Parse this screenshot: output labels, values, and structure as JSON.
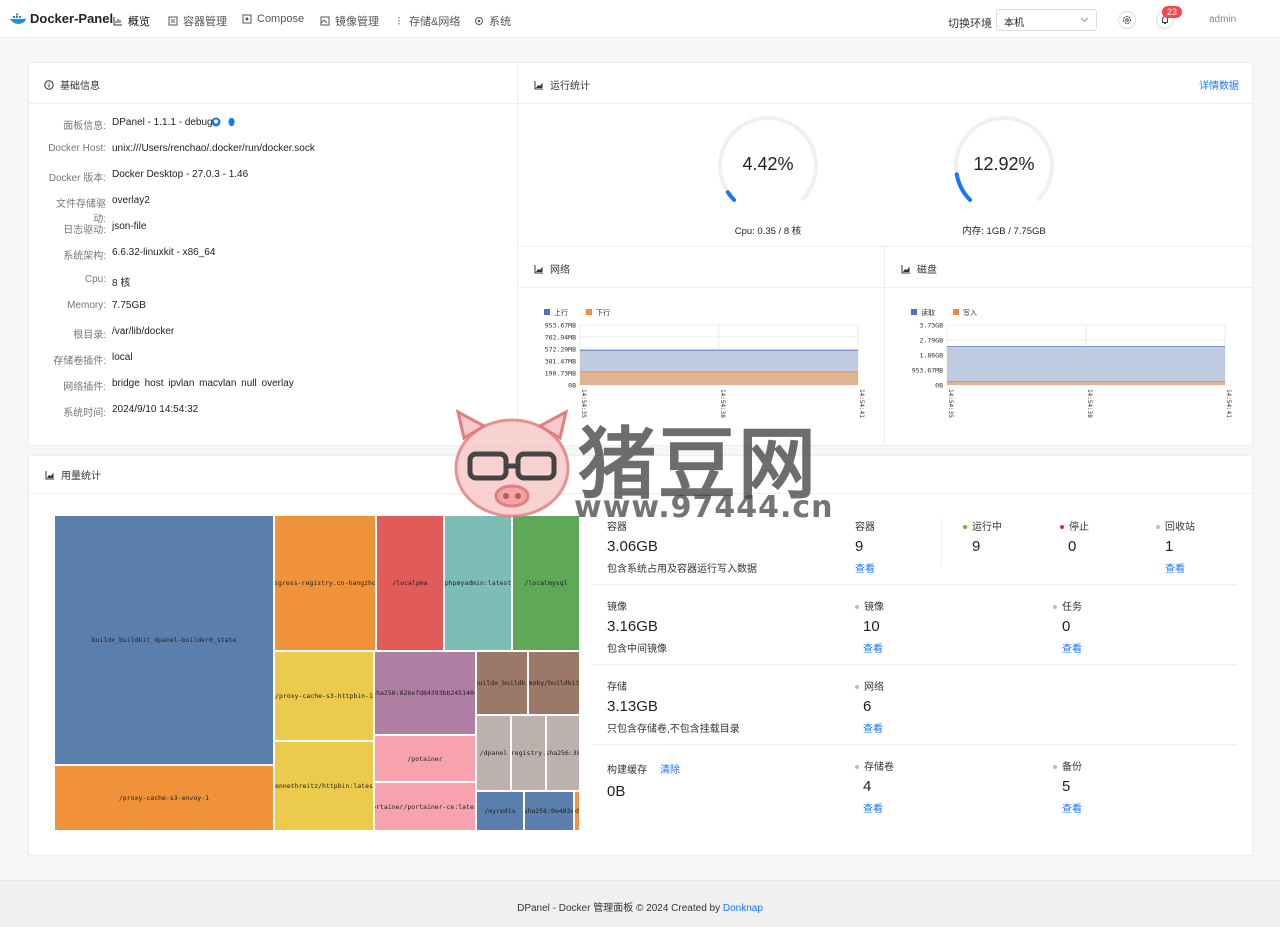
{
  "app": {
    "title": "Docker-Panel"
  },
  "nav": [
    {
      "label": "概览",
      "icon": "chart-icon"
    },
    {
      "label": "容器管理",
      "icon": "container-icon"
    },
    {
      "label": "Compose",
      "icon": "compose-icon"
    },
    {
      "label": "镜像管理",
      "icon": "image-icon"
    },
    {
      "label": "存储&网络",
      "icon": "storage-icon"
    },
    {
      "label": "系统",
      "icon": "gear-icon"
    }
  ],
  "header": {
    "env_label": "切换环境",
    "env_value": "本机",
    "notification_count": "23",
    "user": "admin"
  },
  "basic": {
    "title": "基础信息",
    "rows": [
      {
        "label": "面板信息:",
        "value": "DPanel - 1.1.1 - debug"
      },
      {
        "label": "Docker Host:",
        "value": "unix:///Users/renchao/.docker/run/docker.sock"
      },
      {
        "label": "Docker 版本:",
        "value": "Docker Desktop - 27.0.3 - 1.46"
      },
      {
        "label": "文件存储驱动:",
        "value": "overlay2"
      },
      {
        "label": "日志驱动:",
        "value": "json-file"
      },
      {
        "label": "系统架构:",
        "value": "6.6.32-linuxkit - x86_64"
      },
      {
        "label": "Cpu:",
        "value": "8 核"
      },
      {
        "label": "Memory:",
        "value": "7.75GB"
      },
      {
        "label": "根目录:",
        "value": "/var/lib/docker"
      },
      {
        "label": "存储卷插件:",
        "value": "local"
      },
      {
        "label": "网络插件:",
        "value": "bridge  host  ipvlan  macvlan  null  overlay"
      },
      {
        "label": "系统时间:",
        "value": "2024/9/10 14:54:32"
      }
    ]
  },
  "runtime": {
    "title": "运行统计",
    "detail_link": "详情数据",
    "cpu": {
      "percent": 4.42,
      "label": "4.42%",
      "caption": "Cpu: 0.35 / 8 核"
    },
    "mem": {
      "percent": 12.92,
      "label": "12.92%",
      "caption": "内存: 1GB / 7.75GB"
    }
  },
  "network": {
    "title": "网络",
    "chart_data": {
      "type": "area",
      "series": [
        {
          "name": "上行",
          "values": [
            0,
            0,
            0
          ]
        },
        {
          "name": "下行",
          "values": [
            0,
            0,
            0
          ]
        }
      ],
      "x": [
        "14:54:35",
        "14:54:38",
        "14:54:41"
      ],
      "yticks": [
        "953.67MB",
        "762.94MB",
        "572.20MB",
        "381.47MB",
        "190.73MB",
        "0B"
      ],
      "colors": [
        "#5470c6",
        "#ee8b3a"
      ]
    }
  },
  "disk": {
    "title": "磁盘",
    "chart_data": {
      "type": "area",
      "series": [
        {
          "name": "读取",
          "values": [
            0,
            0,
            0
          ]
        },
        {
          "name": "写入",
          "values": [
            0,
            0,
            0
          ]
        }
      ],
      "x": [
        "14:54:35",
        "14:54:38",
        "14:54:41"
      ],
      "yticks": [
        "3.73GB",
        "2.79GB",
        "1.86GB",
        "953.67MB",
        "0B"
      ],
      "colors": [
        "#5470c6",
        "#ee8b3a"
      ]
    }
  },
  "usage": {
    "title": "用量统计",
    "treemap": [
      {
        "label": "buildx_buildkit_dpanel-builder0_state",
        "color": "#5b7fac"
      },
      {
        "label": "/proxy-cache-s3-envoy-1",
        "color": "#f0923a"
      },
      {
        "label": "higress-registry.cn-hangzhou",
        "color": "#f0923a"
      },
      {
        "label": "/localpma",
        "color": "#e15b5b"
      },
      {
        "label": "phpmyadmin:latest",
        "color": "#7cbdb5"
      },
      {
        "label": "/localmysql",
        "color": "#5ea857"
      },
      {
        "label": "/proxy-cache-s3-httpbin-1",
        "color": "#eccb4c"
      },
      {
        "label": "kennethreitz/httpbin:latest",
        "color": "#eccb4c"
      },
      {
        "label": "sha256:826efd84393bb2451404",
        "color": "#b07ea3"
      },
      {
        "label": "/potainer",
        "color": "#f7a3ae"
      },
      {
        "label": "portainer/portainer-ce:latest",
        "color": "#f7a3ae"
      },
      {
        "label": "/buildx_buildkit",
        "color": "#9b7867"
      },
      {
        "label": "moby/buildkit",
        "color": "#9b7867"
      },
      {
        "label": "/dpanel",
        "color": "#bcb1ad"
      },
      {
        "label": "registry.",
        "color": "#bcb1ad"
      },
      {
        "label": "sha256:38",
        "color": "#bcb1ad"
      },
      {
        "label": "/myredis",
        "color": "#5b7fac"
      },
      {
        "label": "sha256:0e483a",
        "color": "#5b7fac"
      },
      {
        "label": "d",
        "color": "#f0923a"
      }
    ],
    "containers": {
      "title": "容器",
      "size": "3.06GB",
      "desc": "包含系统占用及容器运行写入数据"
    },
    "container_count": {
      "label": "容器",
      "value": "9",
      "link": "查看"
    },
    "running": {
      "label": "运行中",
      "value": "9"
    },
    "stopped": {
      "label": "停止",
      "value": "0"
    },
    "recycle": {
      "label": "回收站",
      "value": "1",
      "link": "查看"
    },
    "images": {
      "title": "镜像",
      "size": "3.16GB",
      "desc": "包含中间镜像"
    },
    "image_count": {
      "label": "镜像",
      "value": "10",
      "link": "查看"
    },
    "tasks": {
      "label": "任务",
      "value": "0",
      "link": "查看"
    },
    "storage": {
      "title": "存储",
      "size": "3.13GB",
      "desc": "只包含存储卷,不包含挂载目录"
    },
    "network_count": {
      "label": "网络",
      "value": "6",
      "link": "查看"
    },
    "build_cache": {
      "title": "构建缓存",
      "clear": "清除",
      "size": "0B"
    },
    "volumes": {
      "label": "存储卷",
      "value": "4",
      "link": "查看"
    },
    "backups": {
      "label": "备份",
      "value": "5",
      "link": "查看"
    },
    "colors": {
      "running": "#52c41a",
      "stopped": "#f5222d",
      "neutral": "#bfbfbf"
    }
  },
  "watermark": {
    "title": "猪豆网",
    "url": "www.97444.cn"
  },
  "footer": {
    "text": "DPanel - Docker 管理面板 © 2024 Created by ",
    "link": "Donknap"
  }
}
